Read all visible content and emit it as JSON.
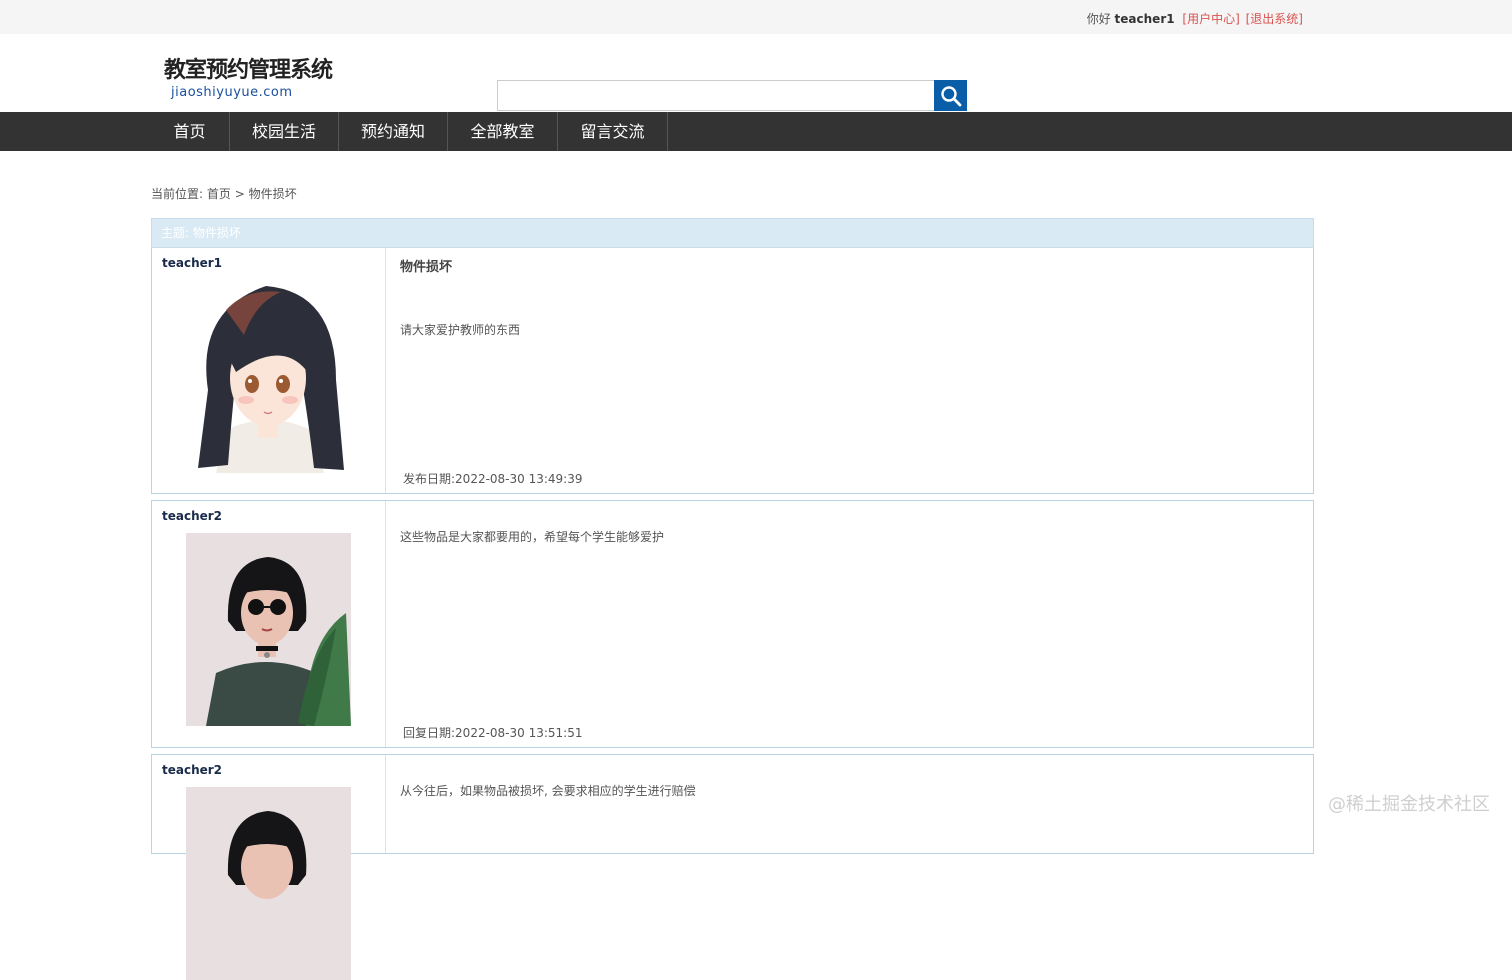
{
  "topbar": {
    "greeting": "你好",
    "username": "teacher1",
    "user_center": "[用户中心]",
    "logout": "[退出系统]"
  },
  "header": {
    "logo_cn": "教室预约管理系统",
    "logo_en": "jiaoshiyuyue.com",
    "search_placeholder": ""
  },
  "nav": {
    "items": [
      "首页",
      "校园生活",
      "预约通知",
      "全部教室",
      "留言交流"
    ]
  },
  "breadcrumb": {
    "prefix": "当前位置:",
    "home": "首页",
    "separator": ">",
    "current": "物件损坏"
  },
  "board": {
    "header": "主题: 物件损坏",
    "posts": [
      {
        "user": "teacher1",
        "title": "物件损坏",
        "content": "请大家爱护教师的东西",
        "date": "发布日期:2022-08-30 13:49:39"
      },
      {
        "user": "teacher2",
        "title": "",
        "content": "这些物品是大家都要用的，希望每个学生能够爱护",
        "date": "回复日期:2022-08-30 13:51:51"
      },
      {
        "user": "teacher2",
        "title": "",
        "content": "从今往后，如果物品被损坏, 会要求相应的学生进行赔偿",
        "date": ""
      }
    ]
  },
  "watermark": "@稀土掘金技术社区",
  "colors": {
    "nav_bg": "#333333",
    "search_button": "#0a5ea8",
    "board_header": "#daeaf4",
    "link_red": "#d9534f"
  }
}
